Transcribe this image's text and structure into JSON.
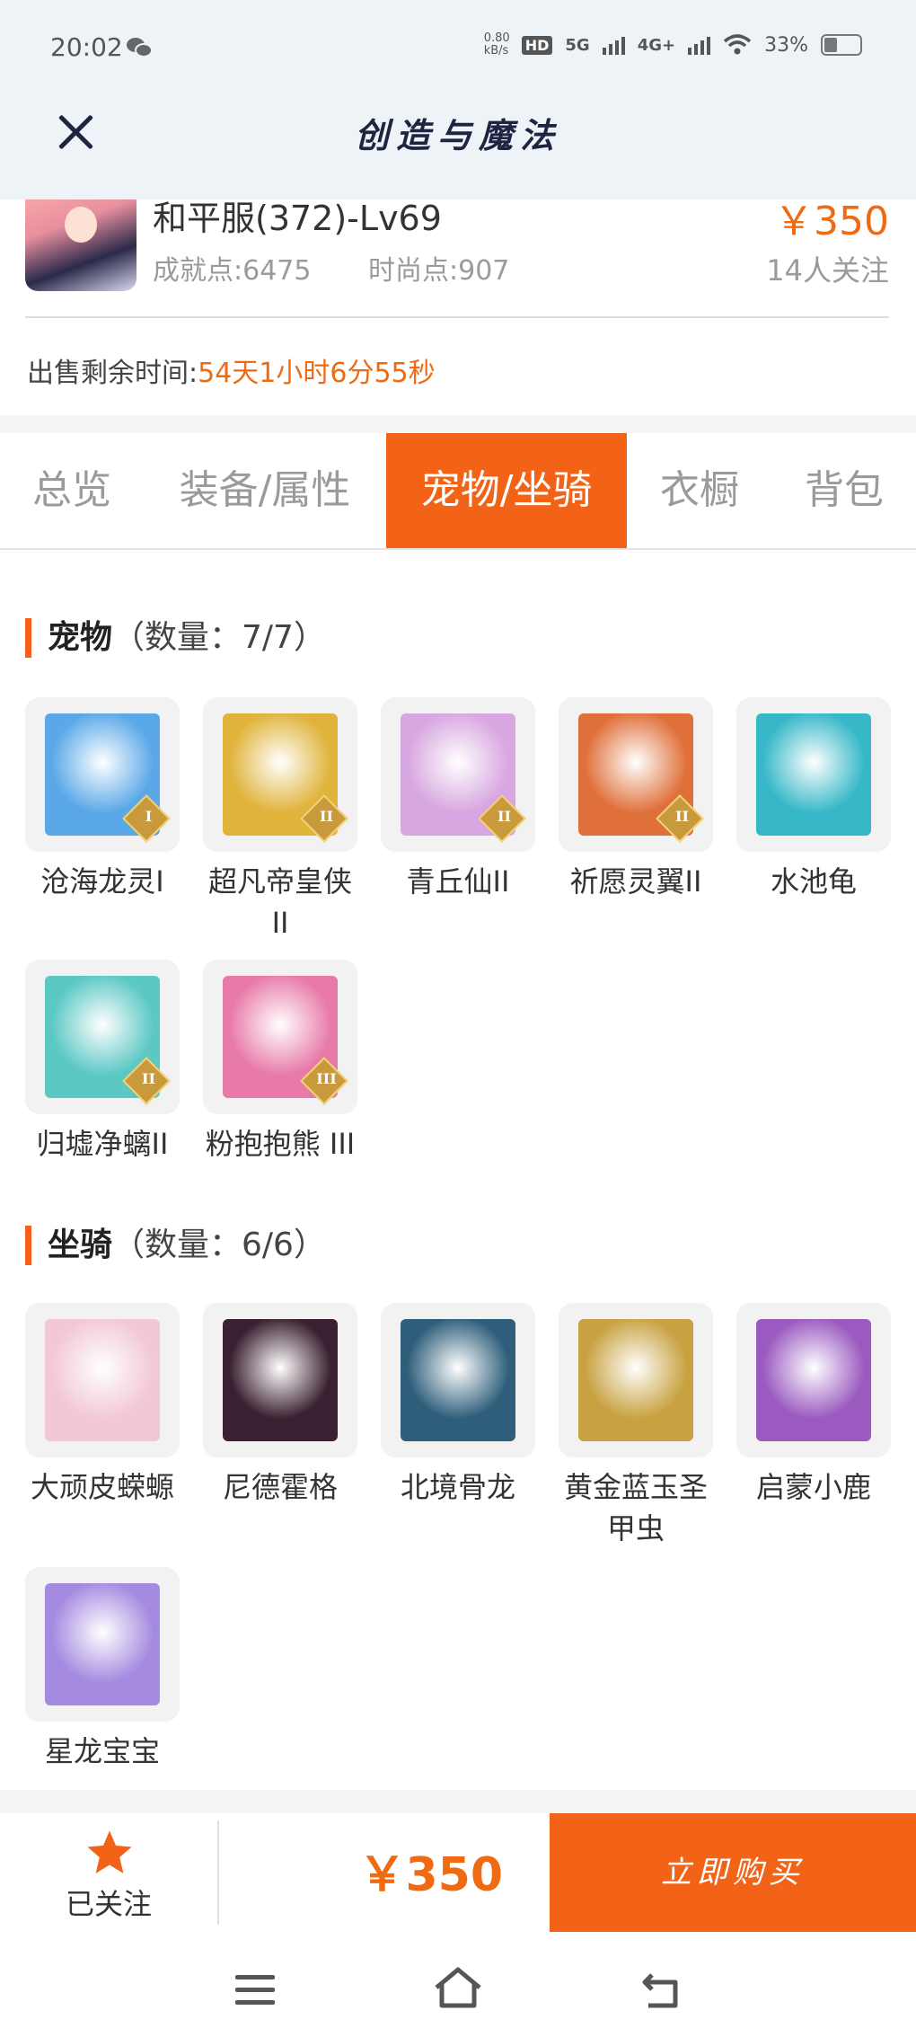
{
  "status_bar": {
    "time": "20:02",
    "net_speed": "0.80 kB/s",
    "hd": "HD",
    "sim1": "5G",
    "sim2": "4G+",
    "battery": "33%"
  },
  "header": {
    "title": "创造与魔法"
  },
  "character": {
    "name": "和平服(372)-Lv69",
    "achievement": "成就点:6475",
    "fashion": "时尚点:907",
    "price": "￥350",
    "watchers": "14人关注",
    "sale_time_label": "出售剩余时间:",
    "sale_time_value": "54天1小时6分55秒"
  },
  "tabs": [
    {
      "label": "总览"
    },
    {
      "label": "装备/属性"
    },
    {
      "label": "宠物/坐骑",
      "active": true
    },
    {
      "label": "衣橱"
    },
    {
      "label": "背包"
    }
  ],
  "pets": {
    "title": "宠物",
    "count": "（数量：7/7）",
    "items": [
      {
        "name": "沧海龙灵I",
        "tier": "I",
        "icon": "blue-dragon-spirit-icon",
        "color": "#5aa8e8"
      },
      {
        "name": "超凡帝皇侠II",
        "tier": "II",
        "icon": "golden-armor-hero-icon",
        "color": "#e0b33a"
      },
      {
        "name": "青丘仙II",
        "tier": "II",
        "icon": "fox-fairy-icon",
        "color": "#d8a6e0"
      },
      {
        "name": "祈愿灵翼II",
        "tier": "II",
        "icon": "phoenix-bird-icon",
        "color": "#e0703a"
      },
      {
        "name": "水池龟",
        "tier": "",
        "icon": "pond-turtle-icon",
        "color": "#36b8c8"
      },
      {
        "name": "归墟净螭II",
        "tier": "II",
        "icon": "cyan-dragon-icon",
        "color": "#5cc8c4"
      },
      {
        "name": "粉抱抱熊 III",
        "tier": "III",
        "icon": "pink-bear-icon",
        "color": "#e87aa8"
      }
    ]
  },
  "mounts": {
    "title": "坐骑",
    "count": "（数量：6/6）",
    "items": [
      {
        "name": "大顽皮蝾螈",
        "icon": "axolotl-icon",
        "color": "#f2c8d8"
      },
      {
        "name": "尼德霍格",
        "icon": "black-dragon-icon",
        "color": "#3a2030"
      },
      {
        "name": "北境骨龙",
        "icon": "bone-dragon-icon",
        "color": "#2e5e7a"
      },
      {
        "name": "黄金蓝玉圣甲虫",
        "icon": "golden-scarab-icon",
        "color": "#c8a240"
      },
      {
        "name": "启蒙小鹿",
        "icon": "mystic-deer-icon",
        "color": "#9a5ac0"
      },
      {
        "name": "星龙宝宝",
        "icon": "baby-star-dragon-icon",
        "color": "#a48ae0"
      }
    ]
  },
  "bottom": {
    "follow_label": "已关注",
    "price": "￥350",
    "buy_label": "立即购买"
  },
  "colors": {
    "accent": "#f26317",
    "price": "#f06a12",
    "header_bg": "#eef3f7"
  }
}
